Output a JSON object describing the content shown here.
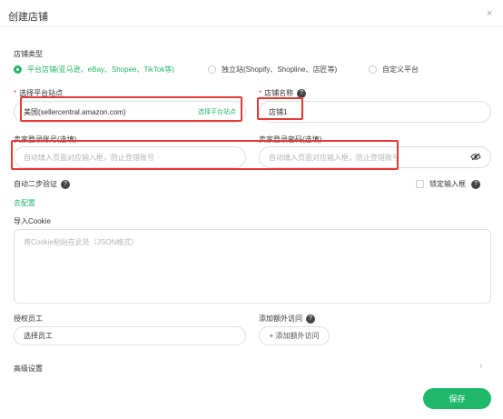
{
  "dialog": {
    "title": "创建店铺",
    "close": "×"
  },
  "store_type": {
    "label": "店铺类型",
    "options": [
      {
        "label": "平台店铺(亚马逊、eBay、Shopee、TikTok等)",
        "selected": true
      },
      {
        "label": "独立站(Shopify、Shopline、店匠等)",
        "selected": false
      },
      {
        "label": "自定义平台",
        "selected": false
      }
    ]
  },
  "site": {
    "label": "选择平台站点",
    "value": "美国(sellercentral.amazon.com)",
    "action": "选择平台站点"
  },
  "store_name": {
    "label": "店铺名称",
    "value": "店铺1"
  },
  "seller_account": {
    "label": "卖家登录账号(选填)",
    "placeholder": "自动填入页面对应输入框，防止登错账号"
  },
  "seller_password": {
    "label": "卖家登录密码(选填)",
    "placeholder": "自动填入页面对应输入框，防止登错账号"
  },
  "two_factor": {
    "label": "自动二步验证",
    "link": "去配置"
  },
  "lock_input": {
    "label": "锁定输入框"
  },
  "cookie": {
    "label": "导入Cookie",
    "placeholder": "将Cookie粘贴在此处（JSON格式）"
  },
  "staff": {
    "label": "授权员工",
    "placeholder": "选择员工"
  },
  "extra_access": {
    "label": "添加额外访问",
    "button": "+ 添加额外访问"
  },
  "advanced": {
    "label": "高级设置"
  },
  "save_button": "保存",
  "colors": {
    "accent": "#26b566",
    "highlight": "#e53935"
  }
}
